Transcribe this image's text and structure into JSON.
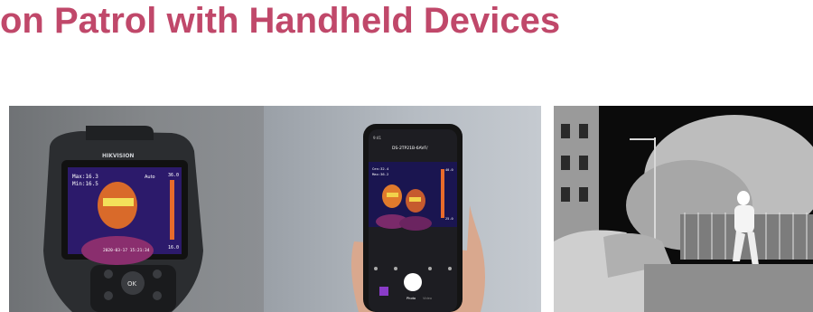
{
  "slide": {
    "title": "on Patrol with Handheld Devices",
    "title_color": "#c0486a"
  },
  "photos": {
    "left": {
      "brand": "HIKVISION",
      "screen_max": "Max:16.3",
      "screen_min": "Min:16.5",
      "screen_mode": "Auto",
      "screen_scale_top": "36.0",
      "screen_scale_bottom": "16.0",
      "screen_date": "2020-03-17 15:21:34",
      "buttons": [
        "OK"
      ]
    },
    "middle": {
      "status_time": "9:41",
      "device_name": "DS-2TP21B-6AVF/",
      "scale_top": "40.0",
      "scale_bottom": "25.0",
      "cen_reading": "Cen:32.4",
      "max_reading": "Max:36.2",
      "mode_photo": "Photo",
      "mode_video": "Video"
    },
    "right": {
      "description_hidden": ""
    }
  }
}
